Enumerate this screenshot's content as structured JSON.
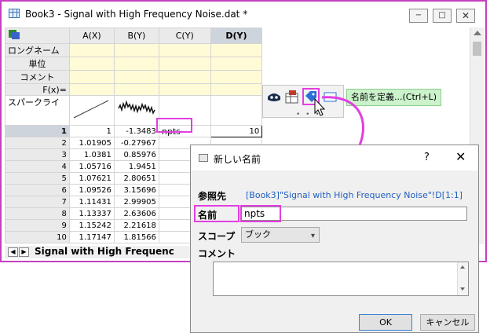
{
  "window": {
    "title": "Book3 - Signal with High Frequency Noise.dat *",
    "min_glyph": "−",
    "max_glyph": "□",
    "close_glyph": "✕"
  },
  "sheet": {
    "columns": [
      "A(X)",
      "B(Y)",
      "C(Y)",
      "D(Y)"
    ],
    "meta_rows": [
      "ロングネーム",
      "単位",
      "コメント",
      "F(x)=",
      "スパークライ"
    ],
    "rows": [
      {
        "n": "1",
        "a": "1",
        "b": "-1.3483",
        "c": "npts",
        "d": "10"
      },
      {
        "n": "2",
        "a": "1.01905",
        "b": "-0.27967",
        "c": "",
        "d": ""
      },
      {
        "n": "3",
        "a": "1.0381",
        "b": "0.85976",
        "c": "",
        "d": ""
      },
      {
        "n": "4",
        "a": "1.05716",
        "b": "1.9451",
        "c": "",
        "d": ""
      },
      {
        "n": "5",
        "a": "1.07621",
        "b": "2.80651",
        "c": "",
        "d": ""
      },
      {
        "n": "6",
        "a": "1.09526",
        "b": "3.15696",
        "c": "",
        "d": ""
      },
      {
        "n": "7",
        "a": "1.11431",
        "b": "2.99905",
        "c": "",
        "d": ""
      },
      {
        "n": "8",
        "a": "1.13337",
        "b": "2.63606",
        "c": "",
        "d": ""
      },
      {
        "n": "9",
        "a": "1.15242",
        "b": "2.21618",
        "c": "",
        "d": ""
      },
      {
        "n": "10",
        "a": "1.17147",
        "b": "1.81566",
        "c": "",
        "d": ""
      }
    ],
    "tab_label": "Signal with High Frequenc",
    "nav_prev": "◀",
    "nav_next": "▶"
  },
  "mini_toolbar": {
    "icons": [
      "mask-icon",
      "table-icon",
      "tag-icon",
      "window-icon"
    ],
    "dots": "• • •",
    "tooltip": "名前を定義...(Ctrl+L)"
  },
  "dialog": {
    "title": "新しい名前",
    "help": "?",
    "close": "✕",
    "ref_label": "参照先",
    "ref_value": "[Book3]\"Signal with High Frequency Noise\"!D[1:1]",
    "name_label": "名前",
    "name_value": "npts",
    "scope_label": "スコープ",
    "scope_value": "ブック",
    "comment_label": "コメント",
    "ok": "OK",
    "cancel": "キャンセル"
  },
  "colors": {
    "highlight": "#e23ee0",
    "meta_bg": "#fffbd6",
    "tooltip_bg": "#cbf2cb",
    "link_blue": "#1f5fbf"
  }
}
